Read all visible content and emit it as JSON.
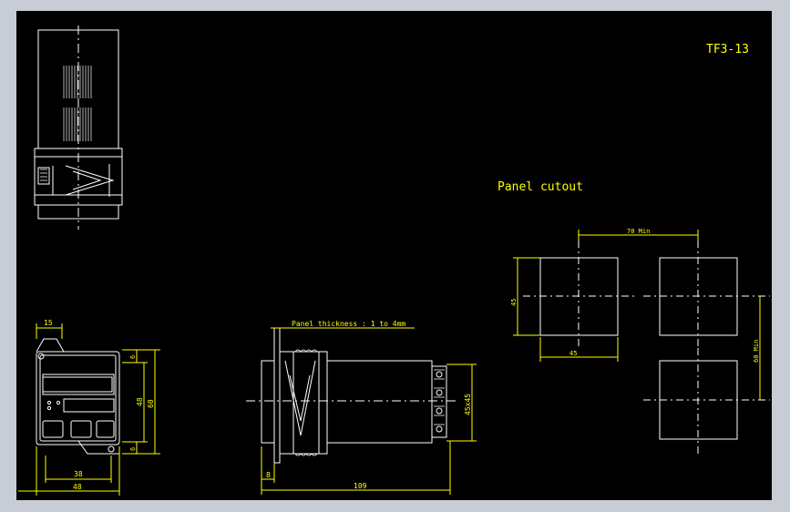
{
  "drawing": {
    "title": "TF3-13",
    "panel_cutout_label": "Panel cutout",
    "panel_thickness_note": "Panel thickness : 1 to 4mm",
    "dimensions": {
      "front_top_width": "15",
      "front_overall_width": "48",
      "front_inner_width": "38",
      "front_height_inner": "48",
      "front_height_overall": "60",
      "front_small_top": "6",
      "front_small_bottom": "6",
      "side_panel_offset": "8",
      "side_length": "109",
      "side_height": "45x45",
      "cutout_horizontal_spacing": "70 Min",
      "cutout_vertical_spacing": "60 Min",
      "cutout_width": "45",
      "cutout_height": "45"
    }
  },
  "colors": {
    "background": "#000000",
    "outline": "#ffffff",
    "dimension": "#ffff00"
  }
}
